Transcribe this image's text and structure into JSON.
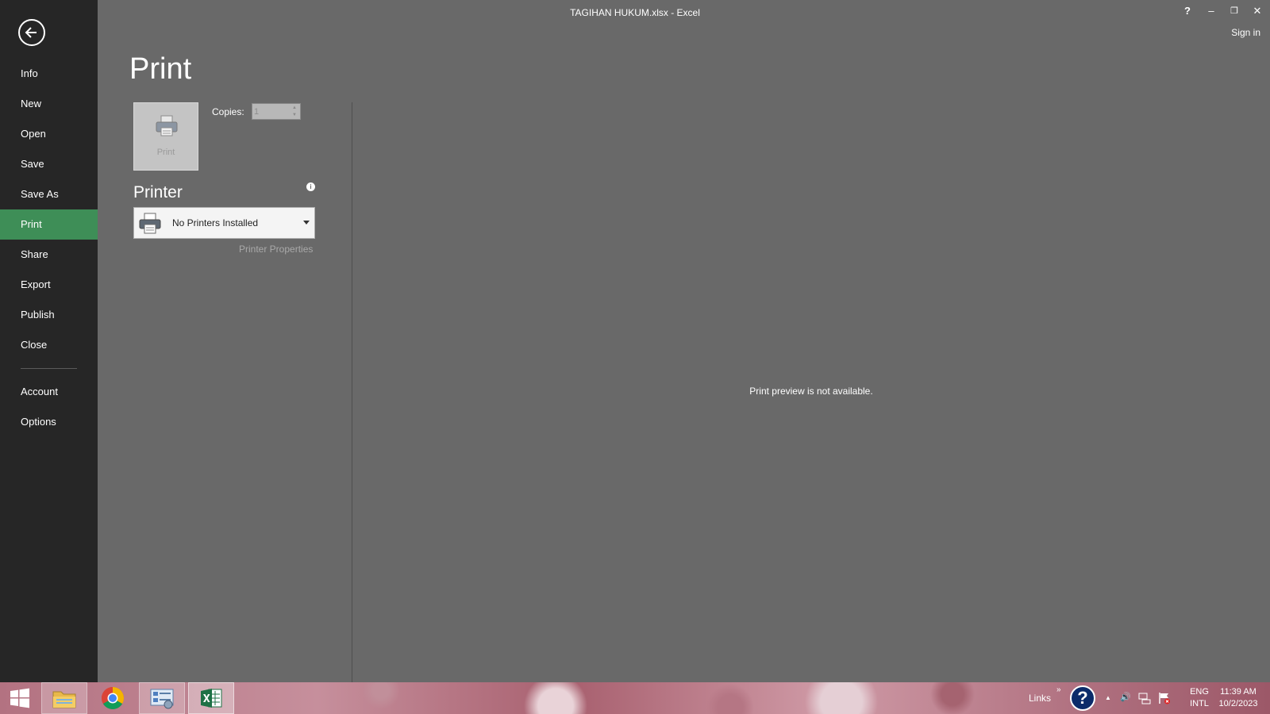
{
  "window": {
    "title": "TAGIHAN HUKUM.xlsx - Excel",
    "help_glyph": "?",
    "minimize_glyph": "–",
    "restore_glyph": "❐",
    "close_glyph": "✕",
    "sign_in": "Sign in"
  },
  "nav": {
    "items": [
      {
        "label": "Info"
      },
      {
        "label": "New"
      },
      {
        "label": "Open"
      },
      {
        "label": "Save"
      },
      {
        "label": "Save As"
      },
      {
        "label": "Print",
        "active": true
      },
      {
        "label": "Share"
      },
      {
        "label": "Export"
      },
      {
        "label": "Publish"
      },
      {
        "label": "Close"
      },
      {
        "label": "Account"
      },
      {
        "label": "Options"
      }
    ]
  },
  "print": {
    "heading": "Print",
    "button_label": "Print",
    "copies_label": "Copies:",
    "copies_value": "1",
    "printer_heading": "Printer",
    "info_glyph": "i",
    "printer_name": "No Printers Installed",
    "printer_properties": "Printer Properties",
    "preview_message": "Print preview is not available."
  },
  "taskbar": {
    "apps": [
      "start-icon",
      "file-explorer-icon",
      "chrome-icon",
      "control-panel-icon",
      "excel-icon"
    ],
    "links_label": "Links",
    "links_chevron": "»",
    "help_glyph": "?",
    "tray_up_glyph": "▲",
    "volume_glyph": "🔊",
    "lang_line1": "ENG",
    "lang_line2": "INTL",
    "time": "11:39 AM",
    "date": "10/2/2023"
  },
  "colors": {
    "backstage_nav": "#262626",
    "content_bg": "#696969",
    "active_nav": "#3e8e57"
  }
}
